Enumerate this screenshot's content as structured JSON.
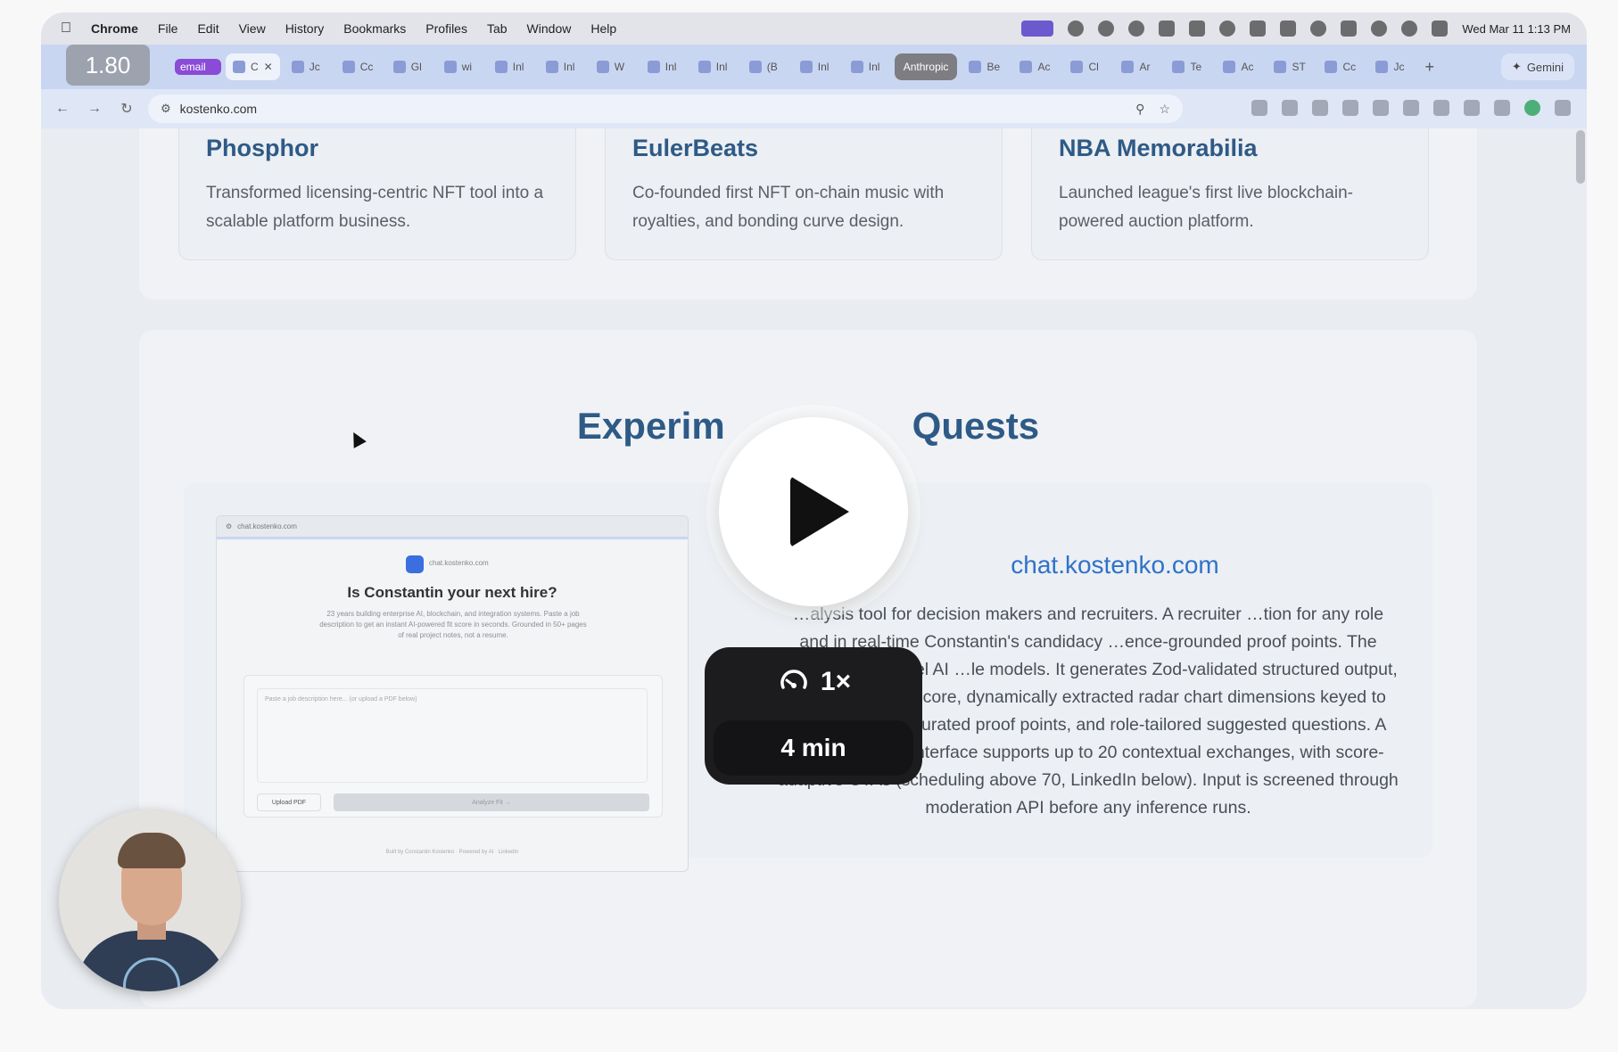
{
  "menubar": {
    "app": "Chrome",
    "items": [
      "File",
      "Edit",
      "View",
      "History",
      "Bookmarks",
      "Profiles",
      "Tab",
      "Window",
      "Help"
    ],
    "datetime": "Wed Mar 11  1:13 PM"
  },
  "tabs": {
    "email_badge": "email",
    "active": "C",
    "labels": [
      "Jc",
      "Cc",
      "Gl",
      "wi",
      "Inl",
      "Inl",
      "W",
      "Inl",
      "Inl",
      "(B",
      "Inl",
      "Inl"
    ],
    "group_label": "Anthropic",
    "labels_after": [
      "Be",
      "Ac",
      "Cl",
      "Ar",
      "Te",
      "Ac",
      "ST",
      "Cc",
      "Jc"
    ],
    "new_tab": "+",
    "gemini": "Gemini"
  },
  "toolbar": {
    "url": "kostenko.com"
  },
  "cards": [
    {
      "title": "Phosphor",
      "desc": "Transformed licensing-centric NFT tool into a scalable platform business."
    },
    {
      "title": "EulerBeats",
      "desc": "Co-founded first NFT on-chain music with royalties, and bonding curve design."
    },
    {
      "title": "NBA Memorabilia",
      "desc": "Launched league's first live blockchain-powered auction platform."
    }
  ],
  "experiments": {
    "title": "Experiments & Side Quests",
    "title_visible_left": "Experim",
    "title_visible_right": "Quests",
    "link": "chat.kostenko.com",
    "body": "…alysis tool for decision makers and recruiters. A recruiter …tion for any role and in real-time Constantin's candidacy …ence-grounded proof points. The system uses Vercel AI …le models. It generates Zod-validated structured output, a 0–100 overall score, dynamically extracted radar chart dimensions keyed to the specific JD, curated proof points, and role-tailored suggested questions. A streaming chat interface supports up to 20 contextual exchanges, with score-adaptive CTAs (scheduling above 70, LinkedIn below). Input is screened through moderation API before any inference runs.",
    "mini": {
      "url": "chat.kostenko.com",
      "brand": "chat.kostenko.com",
      "heading": "Is Constantin your next hire?",
      "sub": "23 years building enterprise AI, blockchain, and integration systems. Paste a job description to get an instant AI-powered fit score in seconds. Grounded in 50+ pages of real project notes, not a resume.",
      "placeholder": "Paste a job description here... (or upload a PDF below)",
      "upload": "Upload PDF",
      "analyze": "Analyze Fit →",
      "footer": "Built by Constantin Kostenko · Powered by AI · LinkedIn"
    }
  },
  "video": {
    "speed": "1×",
    "duration": "4 min",
    "zoom": "1.80"
  }
}
